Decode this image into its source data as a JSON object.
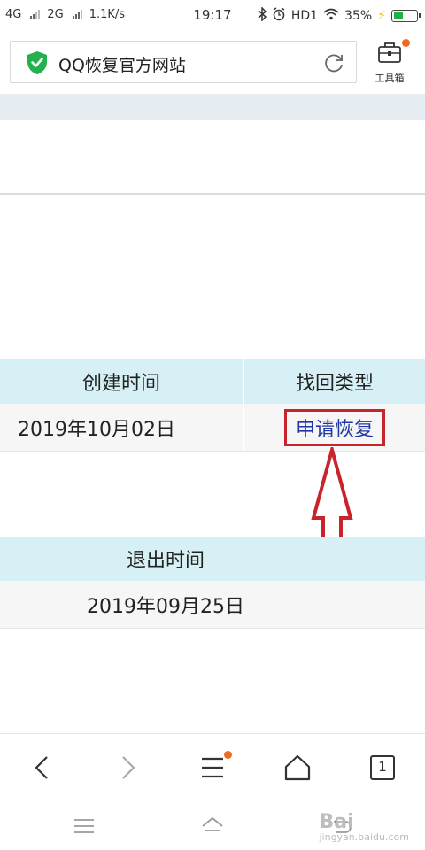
{
  "status": {
    "net1": "4G",
    "net2": "2G",
    "speed": "1.1K/s",
    "time": "19:17",
    "hd": "HD1",
    "battery": "35%"
  },
  "browser": {
    "page_title": "QQ恢复官方网站",
    "toolbox_label": "工具箱",
    "tab_count": "1"
  },
  "table1": {
    "headers": [
      "创建时间",
      "找回类型"
    ],
    "row": {
      "date": "2019年10月02日",
      "action": "申请恢复"
    }
  },
  "table2": {
    "header": "退出时间",
    "row": {
      "date": "2019年09月25日"
    }
  },
  "watermark": {
    "text": "Bai",
    "sub": "jingyan.baidu.com"
  },
  "colors": {
    "header_bg": "#d7f0f6",
    "link": "#1f36a8",
    "highlight": "#c8242c",
    "notify_dot": "#f26a21",
    "shield": "#22b14c"
  }
}
